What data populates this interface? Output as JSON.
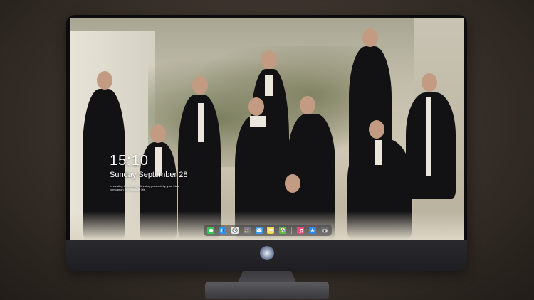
{
  "lock_screen": {
    "time": "15:10",
    "date": "Sunday September 28",
    "tagline": "Innovating technology, Elevating productivity, your ideal companion for a smarter life"
  },
  "dock": {
    "apps": [
      {
        "icon": "messages-icon",
        "color": "#34c759"
      },
      {
        "icon": "finder-icon",
        "color": "#2f8ef5"
      },
      {
        "icon": "clock-icon",
        "color": "#e8e8e8"
      },
      {
        "icon": "launchpad-icon",
        "color": "#7a7a80"
      },
      {
        "icon": "mail-icon",
        "color": "#3a9cf0"
      },
      {
        "icon": "notes-icon",
        "color": "#f5d547"
      },
      {
        "icon": "photos-icon",
        "color": "#5fb84b"
      },
      {
        "icon": "music-icon",
        "color": "#f0477a"
      },
      {
        "icon": "app-store-icon",
        "color": "#2e86f0"
      },
      {
        "icon": "camera-icon",
        "color": "#6b6b70"
      }
    ]
  },
  "colors": {
    "background": "#3b332c",
    "bezel": "#0c0c0e",
    "chin": "#2a2a2e"
  }
}
